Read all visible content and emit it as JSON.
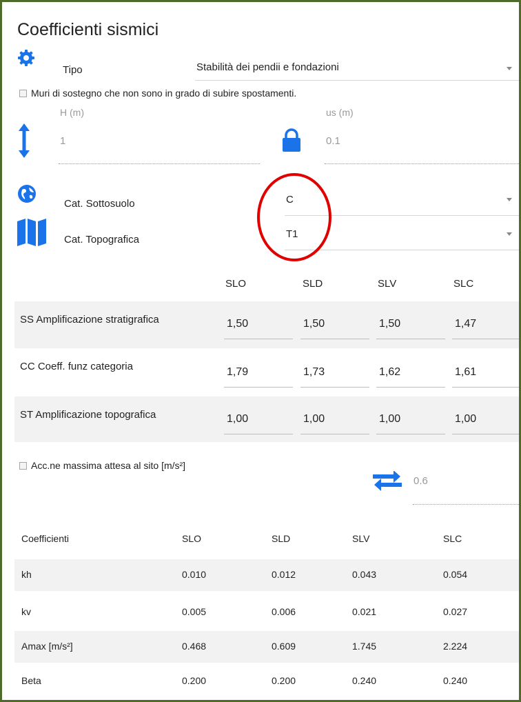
{
  "title": "Coefficienti sismici",
  "tipo": {
    "label": "Tipo",
    "value": "Stabilità dei pendii e fondazioni"
  },
  "muri_checkbox": {
    "label": "Muri di sostegno che non sono in grado di subire spostamenti."
  },
  "h": {
    "label": "H (m)",
    "value": "1"
  },
  "us": {
    "label": "us (m)",
    "value": "0.1"
  },
  "sottosuolo": {
    "label": "Cat. Sottosuolo",
    "value": "C"
  },
  "topografica": {
    "label": "Cat. Topografica",
    "value": "T1"
  },
  "grid": {
    "headers": [
      "SLO",
      "SLD",
      "SLV",
      "SLC"
    ],
    "rows": [
      {
        "label": "SS Amplificazione stratigrafica",
        "values": [
          "1,50",
          "1,50",
          "1,50",
          "1,47"
        ]
      },
      {
        "label": "CC Coeff. funz categoria",
        "values": [
          "1,79",
          "1,73",
          "1,62",
          "1,61"
        ]
      },
      {
        "label": "ST Amplificazione topografica",
        "values": [
          "1,00",
          "1,00",
          "1,00",
          "1,00"
        ]
      }
    ]
  },
  "acc_checkbox": {
    "label": "Acc.ne massima attesa al sito [m/s²]"
  },
  "acc_value": "0.6",
  "coeff_table": {
    "headers": [
      "Coefficienti",
      "SLO",
      "SLD",
      "SLV",
      "SLC"
    ],
    "rows": [
      [
        "kh",
        "0.010",
        "0.012",
        "0.043",
        "0.054"
      ],
      [
        "kv",
        "0.005",
        "0.006",
        "0.021",
        "0.027"
      ],
      [
        "Amax [m/s²]",
        "0.468",
        "0.609",
        "1.745",
        "2.224"
      ],
      [
        "Beta",
        "0.200",
        "0.200",
        "0.240",
        "0.240"
      ]
    ]
  },
  "colors": {
    "icon_blue": "#1a73e8",
    "highlight_red": "#e00000",
    "border_green": "#4e6b2a"
  },
  "icons": [
    "gear-icon",
    "vertical-arrows-icon",
    "lock-icon",
    "globe-icon",
    "map-icon",
    "swap-arrows-icon"
  ]
}
